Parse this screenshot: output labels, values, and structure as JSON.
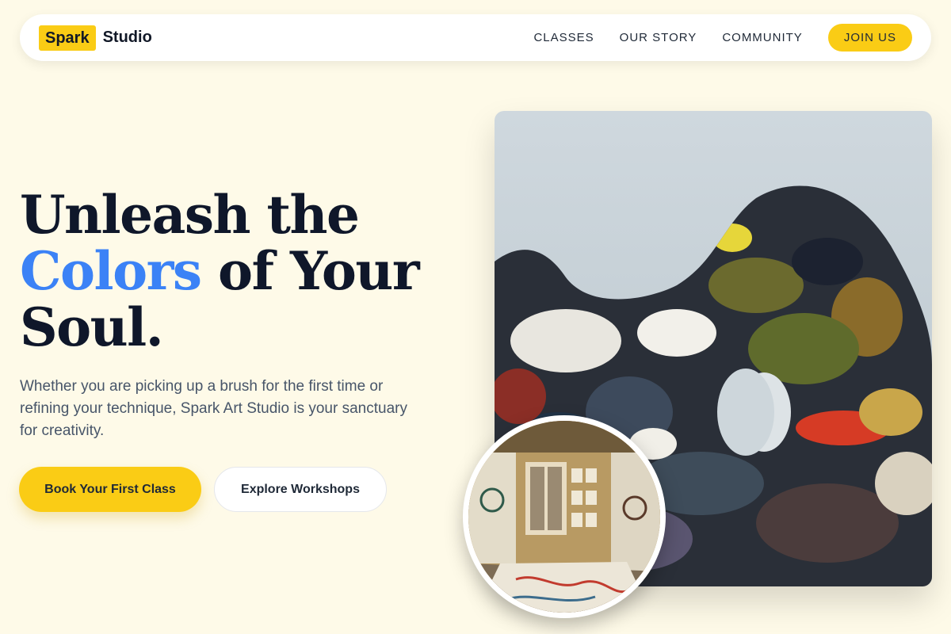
{
  "brand": {
    "badge": "Spark",
    "name": "Studio"
  },
  "nav": {
    "links": [
      "CLASSES",
      "OUR STORY",
      "COMMUNITY"
    ],
    "cta": "JOIN US"
  },
  "hero": {
    "title_line1": "Unleash the",
    "title_accent": "Colors",
    "title_line2_rest": " of Your",
    "title_line3": "Soul.",
    "subtitle": "Whether you are picking up a brush for the first time or refining your technique, Spark Art Studio is your sanctuary for creativity.",
    "primary_button": "Book Your First Class",
    "secondary_button": "Explore Workshops"
  },
  "images": {
    "main": "paint-palette-photo",
    "secondary": "art-studio-room-photo"
  },
  "colors": {
    "background": "#fefae8",
    "accent_yellow": "#facc15",
    "accent_blue": "#3b82f6",
    "heading": "#0f172a",
    "body_text": "#475569"
  }
}
